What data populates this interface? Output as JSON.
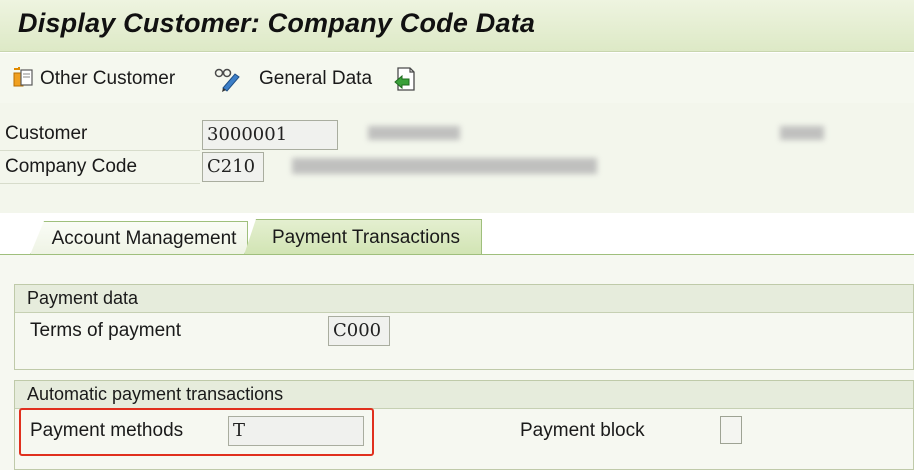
{
  "window": {
    "title": "Display Customer: Company Code Data"
  },
  "toolbar": {
    "other_customer_label": "Other Customer",
    "general_data_label": "General Data"
  },
  "header": {
    "customer_label": "Customer",
    "customer_value": "3000001",
    "company_code_label": "Company Code",
    "company_code_value": "C210"
  },
  "tabs": [
    {
      "label": "Account Management",
      "active": false
    },
    {
      "label": "Payment Transactions",
      "active": true
    }
  ],
  "payment_data": {
    "group_title": "Payment data",
    "terms_label": "Terms of payment",
    "terms_value": "C000"
  },
  "automatic_payment": {
    "group_title": "Automatic payment transactions",
    "methods_label": "Payment methods",
    "methods_value": "T",
    "block_label": "Payment block",
    "block_checked": false
  },
  "colors": {
    "title_bar": "#dde9c6",
    "tab_active": "#d1e4b3",
    "highlight_border": "#e0301e"
  },
  "icons": {
    "other_customer": "customer-switch-icon",
    "general_data": "glasses-pen-icon",
    "back_nav": "document-back-icon"
  }
}
